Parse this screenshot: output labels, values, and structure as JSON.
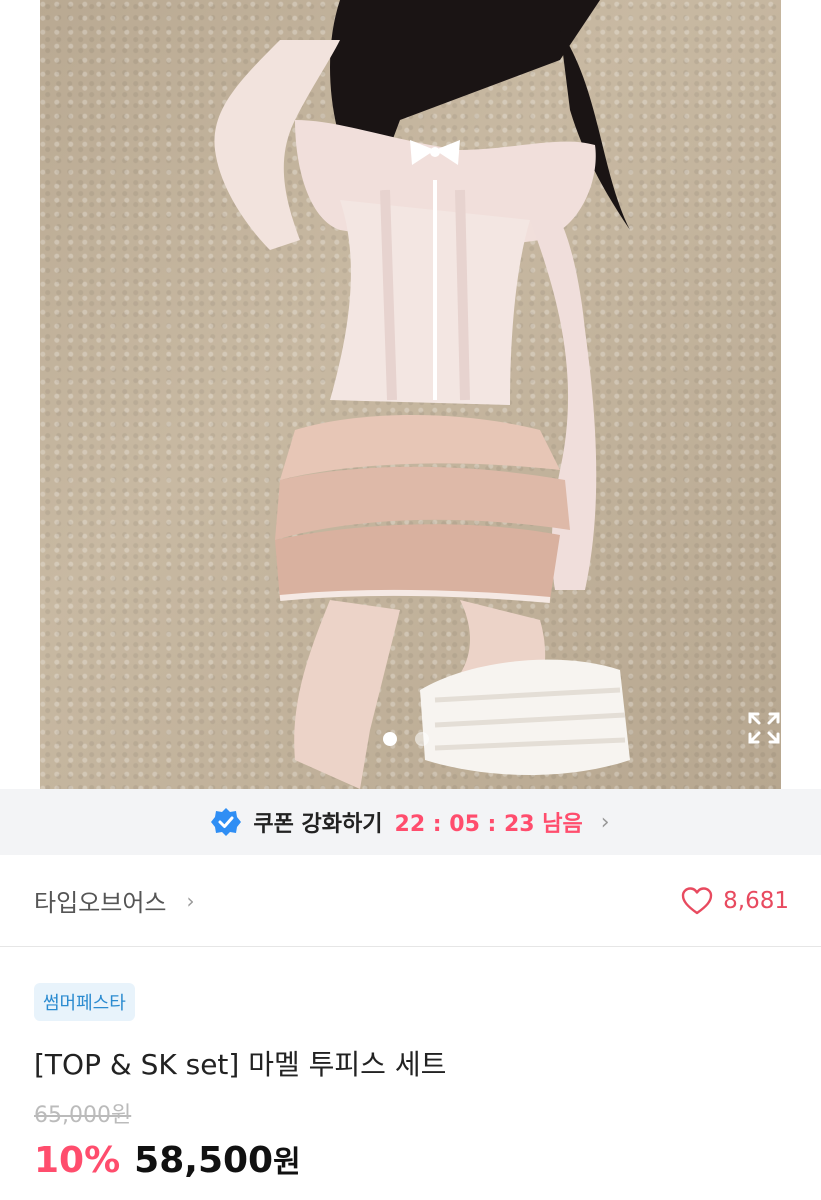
{
  "coupon": {
    "label": "쿠폰 강화하기",
    "timer": "22 : 05 : 23 남음"
  },
  "brand": {
    "name": "타입오브어스",
    "likes": "8,681"
  },
  "product": {
    "badge": "썸머페스타",
    "title": "[TOP & SK set] 마멜 투피스 세트",
    "original_price": "65,000원",
    "discount": "10%",
    "price": "58,500",
    "currency": "원"
  },
  "carousel": {
    "total": 2,
    "current": 1
  },
  "colors": {
    "accent": "#ff4d6d",
    "verified_blue": "#2f8ef4",
    "badge_text": "#2b8bd0"
  }
}
